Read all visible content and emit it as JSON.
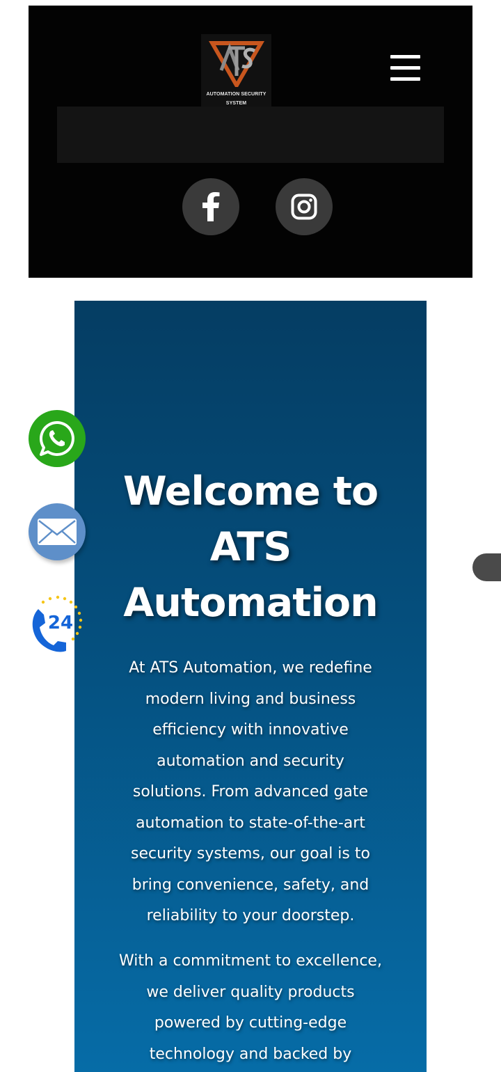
{
  "header": {
    "logo": {
      "mark_text": "ATS",
      "caption_line1": "AUTOMATION SECURITY",
      "caption_line2": "SYSTEM"
    },
    "menu_icon": "hamburger-menu-icon",
    "social": [
      {
        "name": "Facebook",
        "icon": "facebook-icon"
      },
      {
        "name": "Instagram",
        "icon": "instagram-icon"
      }
    ]
  },
  "hero": {
    "title_line1": "Welcome to",
    "title_line2": "ATS",
    "title_line3": "Automation",
    "paragraph1_lines": [
      "At ATS Automation, we redefine",
      "modern living and business",
      "efficiency with innovative",
      "automation and security",
      "solutions. From advanced gate",
      "automation to state-of-the-art",
      "security systems, our goal is to",
      "bring convenience, safety, and",
      "reliability to your doorstep."
    ],
    "paragraph2_lines": [
      "With a commitment to excellence,",
      "we deliver quality products",
      "powered by cutting-edge",
      "technology and backed by"
    ]
  },
  "floating_buttons": [
    {
      "icon": "whatsapp-icon"
    },
    {
      "icon": "email-icon"
    },
    {
      "icon": "phone-24-icon",
      "label": "24"
    }
  ],
  "colors": {
    "header_bg": "#030303",
    "hero_top": "#053d63",
    "hero_bottom": "#066ca7",
    "logo_accent": "#c8561e",
    "whatsapp_green": "#29a71a",
    "mail_blue": "#5e8fc9",
    "phone_blue": "#1565d8",
    "phone_dots": "#f5c518"
  }
}
